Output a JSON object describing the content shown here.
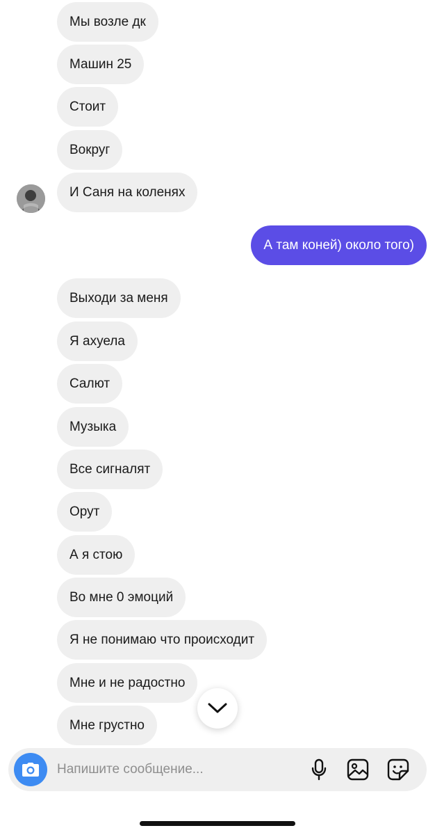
{
  "incoming_top": [
    "Мы возле дк",
    "Машин 25",
    "Стоит",
    "Вокруг",
    "И Саня на коленях"
  ],
  "outgoing": [
    "А там коней) около того)"
  ],
  "incoming_bottom": [
    "Выходи за меня",
    "Я ахуела",
    "Салют",
    "Музыка",
    "Все сигналят",
    "Орут",
    "А я стою",
    "Во мне 0 эмоций",
    "Я не понимаю что происходит",
    "Мне и не радостно",
    "Мне грустно"
  ],
  "composer": {
    "placeholder": "Напишите сообщение...",
    "icons": {
      "camera": "camera-icon",
      "microphone": "microphone-icon",
      "gallery": "gallery-icon",
      "sticker": "sticker-icon"
    }
  },
  "scroll_button_icon": "chevron-down-icon",
  "colors": {
    "incoming_bubble": "#efefef",
    "outgoing_bubble": "#5b4de6",
    "camera_button": "#3d8bf2",
    "composer_background": "#efefef"
  }
}
